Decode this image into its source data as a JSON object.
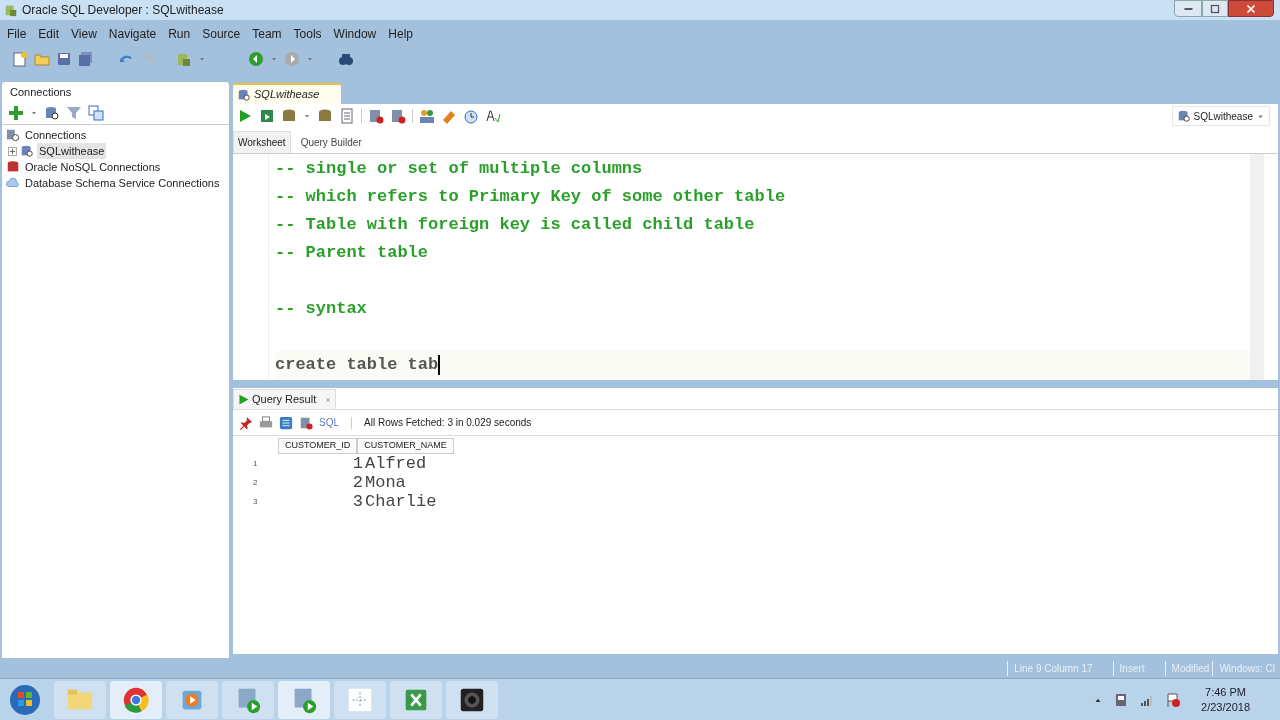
{
  "window": {
    "title": "Oracle SQL Developer : SQLwithease"
  },
  "menu": [
    "File",
    "Edit",
    "View",
    "Navigate",
    "Run",
    "Source",
    "Team",
    "Tools",
    "Window",
    "Help"
  ],
  "connections_panel": {
    "title": "Connections",
    "tree": [
      {
        "label": "Connections",
        "kind": "root",
        "children": [
          {
            "label": "SQLwithease",
            "kind": "db",
            "selected": true,
            "expanded": false
          }
        ]
      },
      {
        "label": "Oracle NoSQL Connections",
        "kind": "nosql"
      },
      {
        "label": "Database Schema Service Connections",
        "kind": "cloud"
      }
    ]
  },
  "editor": {
    "tab": "SQLwithease",
    "connection": "SQLwithease",
    "subtabs": [
      {
        "label": "Worksheet",
        "selected": true
      },
      {
        "label": "Query Builder",
        "selected": false
      }
    ],
    "lines": [
      {
        "kind": "comment",
        "text": "-- single or set of multiple columns"
      },
      {
        "kind": "comment",
        "text": "-- which refers to Primary Key of some other table"
      },
      {
        "kind": "comment",
        "text": "-- Table with foreign key is called child table"
      },
      {
        "kind": "comment",
        "text": "-- Parent table"
      },
      {
        "kind": "blank"
      },
      {
        "kind": "comment",
        "text": "-- syntax"
      },
      {
        "kind": "blank"
      },
      {
        "kind": "code",
        "text": "create table tab",
        "cursor": true
      }
    ]
  },
  "results": {
    "tab": "Query Result",
    "sql_label": "SQL",
    "message": "All Rows Fetched: 3 in 0.029 seconds",
    "columns": [
      "CUSTOMER_ID",
      "CUSTOMER_NAME"
    ],
    "rows": [
      {
        "number": "1",
        "cells": [
          "1",
          "Alfred"
        ]
      },
      {
        "number": "2",
        "cells": [
          "2",
          "Mona"
        ]
      },
      {
        "number": "3",
        "cells": [
          "3",
          "Charlie"
        ]
      }
    ]
  },
  "status_bar": [
    "Line 9 Column 17",
    "Insert",
    "Modified",
    "Windows: Cl"
  ],
  "taskbar": {
    "time": "7:46 PM",
    "date": "2/23/2018"
  }
}
